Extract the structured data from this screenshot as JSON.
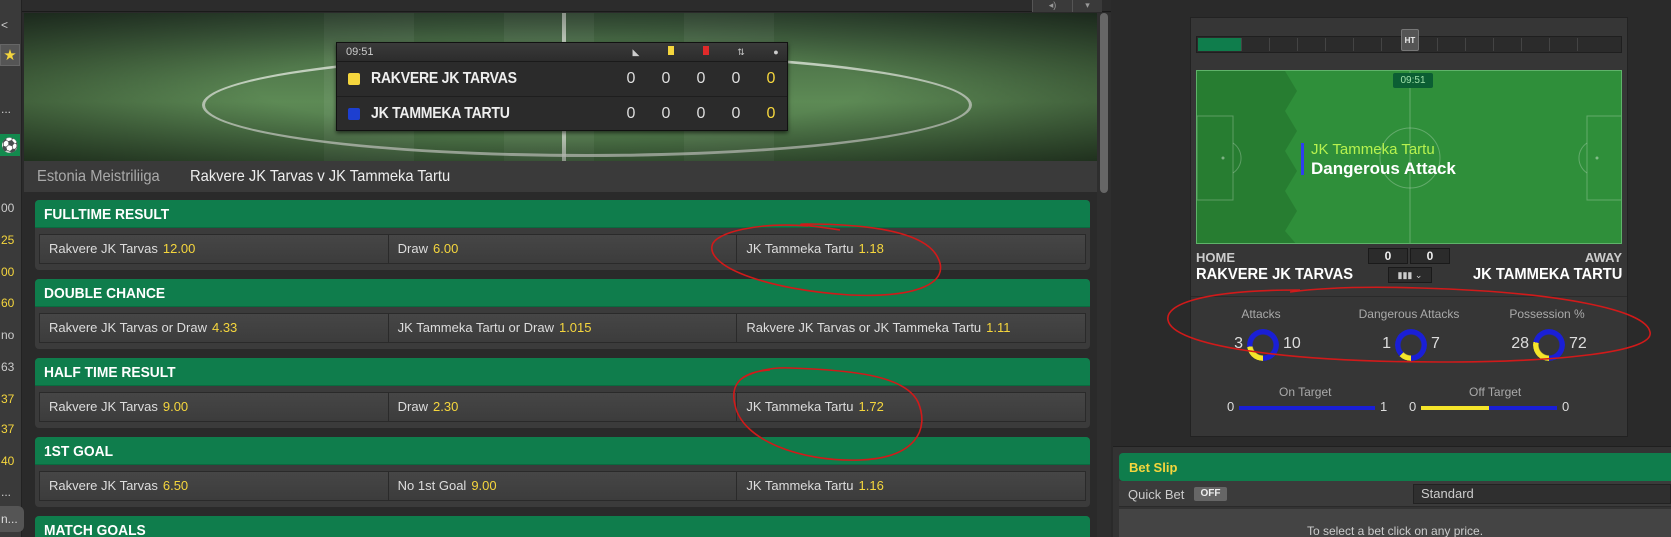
{
  "sidebar_strip": {
    "items": [
      {
        "text": "<"
      },
      {
        "text": "..."
      },
      {
        "text": "00"
      },
      {
        "text": "25"
      },
      {
        "text": "00"
      },
      {
        "text": "60"
      },
      {
        "text": "no"
      },
      {
        "text": "63"
      },
      {
        "text": "37"
      },
      {
        "text": "37"
      },
      {
        "text": "40"
      },
      {
        "text": "..."
      },
      {
        "text": "n..."
      }
    ]
  },
  "scoreboard": {
    "clock": "09:51",
    "header_icons": [
      "corner-icon",
      "yellow-card-icon",
      "red-card-icon",
      "substitution-icon",
      "goal-icon"
    ],
    "teams": [
      {
        "name": "RAKVERE JK TARVAS",
        "shirt_color": "#f5d63d",
        "corners": "0",
        "yellow": "0",
        "red": "0",
        "subs": "0",
        "goals": "0"
      },
      {
        "name": "JK TAMMEKA TARTU",
        "shirt_color": "#1d3fd0",
        "corners": "0",
        "yellow": "0",
        "red": "0",
        "subs": "0",
        "goals": "0"
      }
    ]
  },
  "breadcrumb": {
    "league": "Estonia Meistriliiga",
    "match": "Rakvere JK Tarvas v JK Tammeka Tartu"
  },
  "markets": [
    {
      "title": "FULLTIME RESULT",
      "selections": [
        {
          "name": "Rakvere JK Tarvas",
          "odds": "12.00"
        },
        {
          "name": "Draw",
          "odds": "6.00"
        },
        {
          "name": "JK Tammeka Tartu",
          "odds": "1.18"
        }
      ]
    },
    {
      "title": "DOUBLE CHANCE",
      "selections": [
        {
          "name": "Rakvere JK Tarvas or Draw",
          "odds": "4.33"
        },
        {
          "name": "JK Tammeka Tartu or Draw",
          "odds": "1.015"
        },
        {
          "name": "Rakvere JK Tarvas or JK Tammeka Tartu",
          "odds": "1.11"
        }
      ]
    },
    {
      "title": "HALF TIME RESULT",
      "selections": [
        {
          "name": "Rakvere JK Tarvas",
          "odds": "9.00"
        },
        {
          "name": "Draw",
          "odds": "2.30"
        },
        {
          "name": "JK Tammeka Tartu",
          "odds": "1.72"
        }
      ]
    },
    {
      "title": "1ST GOAL",
      "selections": [
        {
          "name": "Rakvere JK Tarvas",
          "odds": "6.50"
        },
        {
          "name": "No 1st Goal",
          "odds": "9.00"
        },
        {
          "name": "JK Tammeka Tartu",
          "odds": "1.16"
        }
      ]
    },
    {
      "title": "MATCH GOALS",
      "selections": []
    }
  ],
  "match_tracker": {
    "ht_label": "HT",
    "clock": "09:51",
    "event_team": "JK Tammeka Tartu",
    "event_text": "Dangerous Attack",
    "home_label": "HOME",
    "away_label": "AWAY",
    "home_name": "RAKVERE JK TARVAS",
    "away_name": "JK TAMMEKA TARTU",
    "home_score": "0",
    "away_score": "0",
    "stats_dropdown_icon": "bar-chart-icon",
    "stats": [
      {
        "label": "Attacks",
        "home": "3",
        "away": "10",
        "home_share": 0.23
      },
      {
        "label": "Dangerous Attacks",
        "home": "1",
        "away": "7",
        "home_share": 0.125
      },
      {
        "label": "Possession %",
        "home": "28",
        "away": "72",
        "home_share": 0.28
      }
    ],
    "on_target": {
      "label": "On Target",
      "home": "0",
      "away": "1"
    },
    "off_target": {
      "label": "Off Target",
      "home": "0",
      "away": "0"
    },
    "colors": {
      "home": "#f5e52a",
      "away": "#1a1fd6"
    }
  },
  "bet_slip": {
    "title": "Bet Slip",
    "quick_bet_label": "Quick Bet",
    "quick_bet_state": "OFF",
    "mode": "Standard",
    "message": "To select a bet click on any price."
  },
  "colors": {
    "brand_green": "#0f7d4c",
    "odds_yellow": "#f5d63d",
    "annotation_red": "#d11a1a"
  }
}
